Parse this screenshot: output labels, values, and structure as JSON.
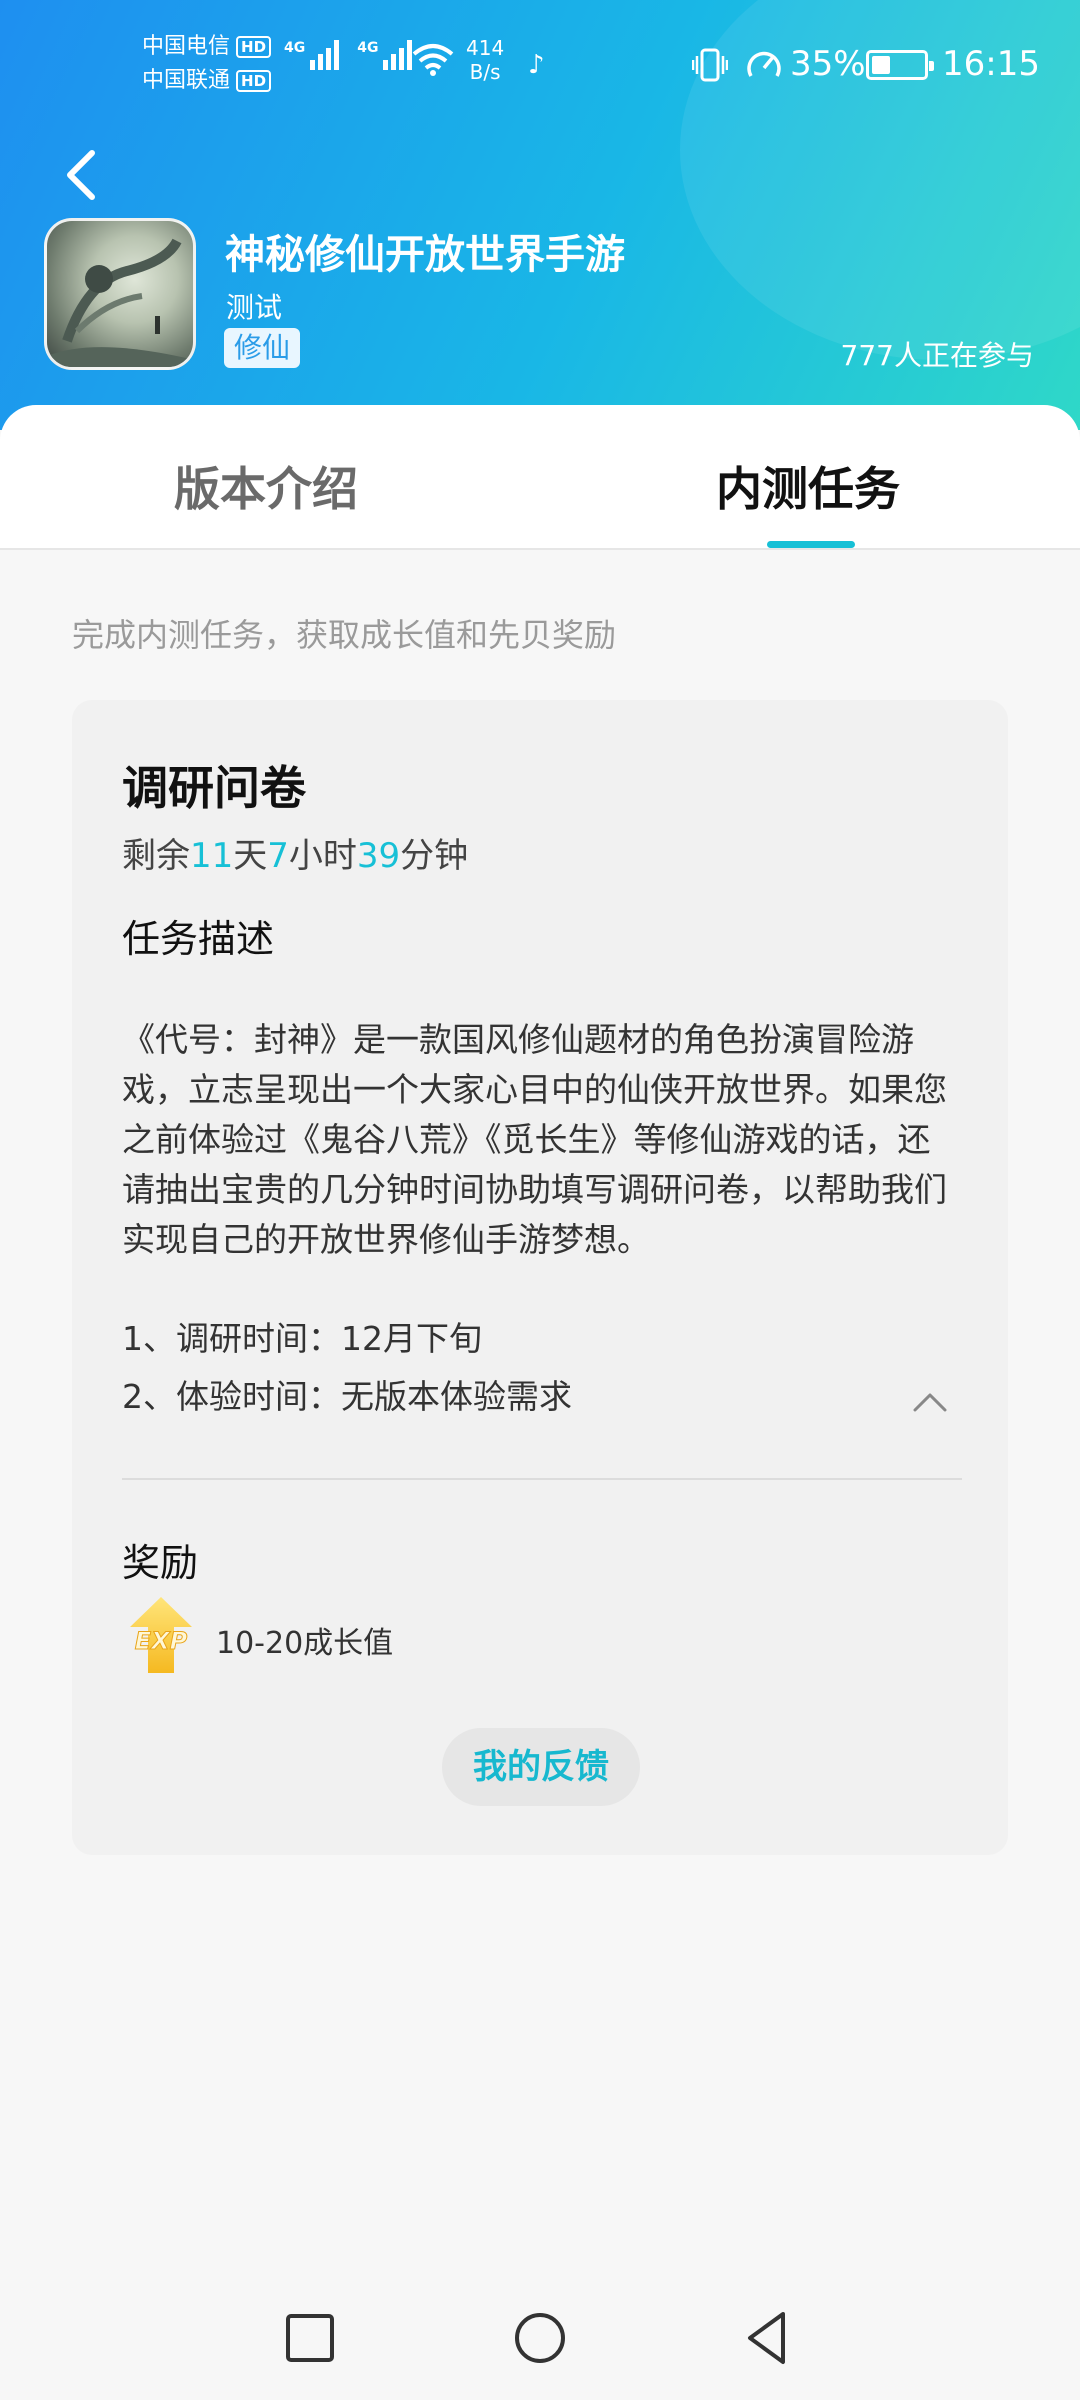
{
  "status_bar": {
    "carrier_1": "中国电信",
    "carrier_2": "中国联通",
    "hd_label": "HD",
    "net_label": "4G",
    "speed_value": "414",
    "speed_unit": "B/s",
    "battery": "35%",
    "time": "16:15"
  },
  "game": {
    "title": "神秘修仙开放世界手游",
    "subtitle": "测试",
    "tag": "修仙",
    "participants": "777人正在参与"
  },
  "tabs": [
    {
      "label": "版本介绍",
      "active": false
    },
    {
      "label": "内测任务",
      "active": true
    }
  ],
  "hint": "完成内测任务，获取成长值和先贝奖励",
  "task": {
    "title": "调研问卷",
    "countdown": {
      "prefix": "剩余",
      "days": "11",
      "days_unit": "天",
      "hours": "7",
      "hours_unit": "小时",
      "minutes": "39",
      "minutes_unit": "分钟"
    },
    "desc_heading": "任务描述",
    "description": "《代号：封神》是一款国风修仙题材的角色扮演冒险游戏，立志呈现出一个大家心目中的仙侠开放世界。如果您之前体验过《鬼谷八荒》《觅长生》等修仙游戏的话，还请抽出宝贵的几分钟时间协助填写调研问卷，以帮助我们实现自己的开放世界修仙手游梦想。",
    "items": [
      "1、调研时间：12月下旬",
      "2、体验时间：无版本体验需求"
    ],
    "reward_heading": "奖励",
    "reward_icon_text": "EXP",
    "reward": "10-20成长值",
    "feedback_button": "我的反馈"
  },
  "colors": {
    "accent": "#17c0d6",
    "header_start": "#1e8ff0",
    "header_end": "#2fd8c8"
  }
}
